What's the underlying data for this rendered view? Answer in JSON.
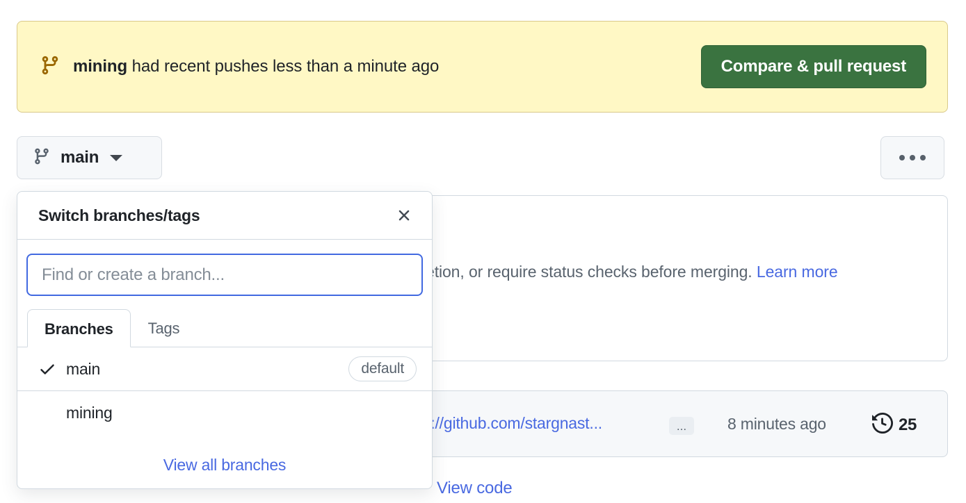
{
  "banner": {
    "icon": "git-branch-icon",
    "branch_name": "mining",
    "message": " had recent pushes less than a minute ago",
    "compare_button_label": "Compare & pull request",
    "bg_color": "#fff8c5",
    "border_color": "#d9c98a",
    "icon_color": "#9a6700",
    "button_color": "#3a7340"
  },
  "branch_button": {
    "icon": "git-branch-icon",
    "label": "main",
    "caret": "chevron-down-icon"
  },
  "more_button": {
    "icon": "kebab-horizontal-icon"
  },
  "background": {
    "notice_text_clipped": "etion, or require status checks before merging.",
    "learn_more_label": "Learn more",
    "commit_url_clipped": "s://github.com/stargnast...",
    "commit_ellipsis_label": "...",
    "commit_time": "8 minutes ago",
    "commit_count": "25",
    "history_icon": "history-icon",
    "view_code_label": "View code"
  },
  "branch_panel": {
    "title": "Switch branches/tags",
    "close_icon": "close-icon",
    "search": {
      "placeholder": "Find or create a branch...",
      "value": "",
      "focus_color": "#4169e1"
    },
    "tabs": [
      {
        "label": "Branches",
        "active": true
      },
      {
        "label": "Tags",
        "active": false
      }
    ],
    "branches": [
      {
        "name": "main",
        "checked": true,
        "badge": "default"
      },
      {
        "name": "mining",
        "checked": false,
        "badge": ""
      }
    ],
    "footer_link": "View all branches"
  }
}
